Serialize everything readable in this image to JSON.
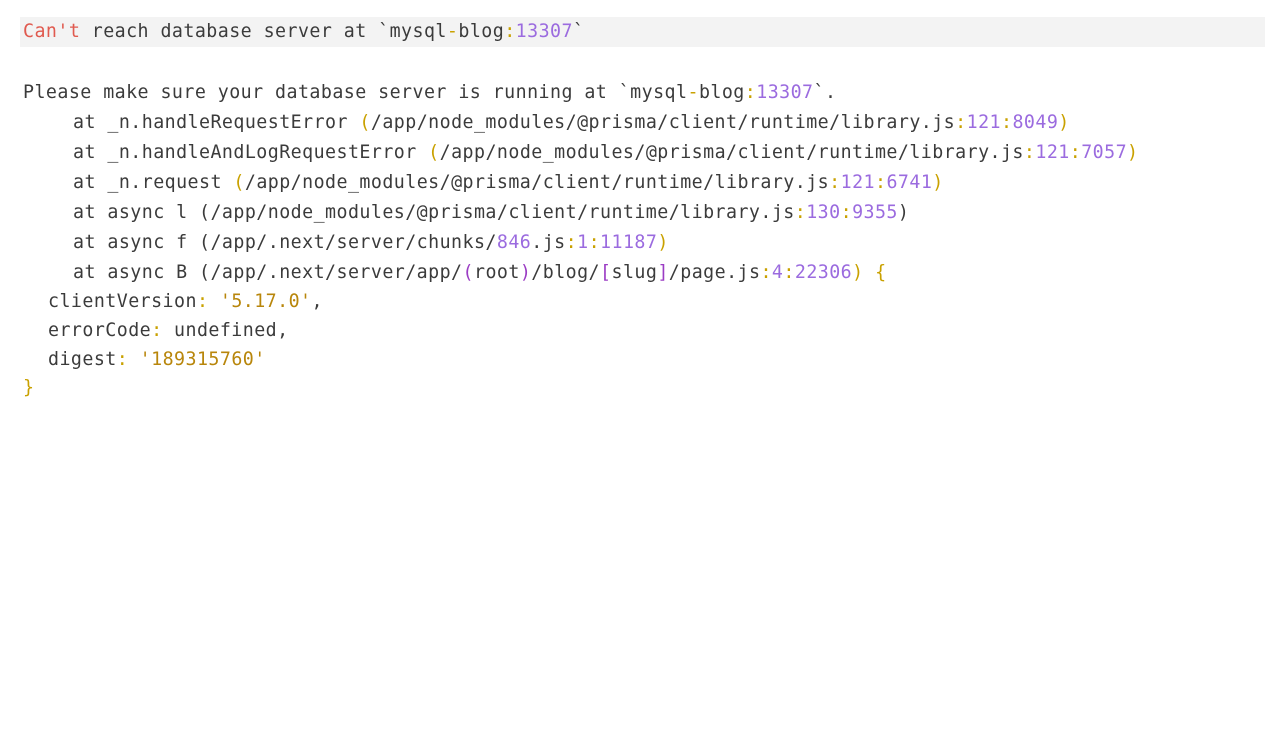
{
  "colors": {
    "background": "#ffffff",
    "highlight_bg": "#f3f3f3",
    "text": "#3b3b3b",
    "number": "#9b6bdf",
    "string": "#b8860b",
    "error_word": "#e05a4f",
    "punct": "#c9a100",
    "path": "#b3a14a",
    "bracket": "#9b3cc4"
  },
  "error_header": {
    "t1": "Can't",
    "t2": " reach database server at `mysql",
    "t3": "-",
    "t4": "blog",
    "t5": ":",
    "t6": "13307",
    "t7": "`"
  },
  "message": {
    "t1": "Please make sure your database server is running at `mysql",
    "t2": "-",
    "t3": "blog",
    "t4": ":",
    "t5": "13307",
    "t6": "`."
  },
  "stack": [
    {
      "t1": "at _n.handleRequestError ",
      "t2": "(",
      "t3": "/app/node_modules/@prisma/client/runtime/library.js",
      "t4": ":",
      "t5": "121",
      "t6": ":",
      "t7": "8049",
      "t8": ")"
    },
    {
      "t1": "at _n.handleAndLogRequestError ",
      "t2": "(",
      "t3": "/app/node_modules/@prisma/client/runtime/library.js",
      "t4": ":",
      "t5": "121",
      "t6": ":",
      "t7": "7057",
      "t8": ")"
    },
    {
      "t1": "at _n.request ",
      "t2": "(",
      "t3": "/app/node_modules/@prisma/client/runtime/library.js",
      "t4": ":",
      "t5": "121",
      "t6": ":",
      "t7": "6741",
      "t8": ")"
    },
    {
      "t1": "at async l (/app/node_modules/@prisma/client/runtime/library.js",
      "t2": ":",
      "t3": "130",
      "t4": ":",
      "t5": "9355",
      "t6": ")"
    },
    {
      "t1": "at async f (/app/.next/server/chunks/",
      "t2": "846",
      "t3": ".js",
      "t4": ":",
      "t5": "1",
      "t6": ":",
      "t7": "11187",
      "t8": ")"
    },
    {
      "t1": "at async B (/app/.next/server/app/",
      "t2": "(",
      "t3": "root",
      "t4": ")",
      "t5": "/blog/",
      "t6": "[",
      "t7": "slug",
      "t8": "]",
      "t9": "/page.js",
      "t10": ":",
      "t11": "4",
      "t12": ":",
      "t13": "22306",
      "t14": ") ",
      "t15": "{"
    }
  ],
  "props": [
    {
      "key": "clientVersion",
      "colon": ": ",
      "value": "'5.17.0'",
      "tail": ","
    },
    {
      "key": "errorCode",
      "colon": ": ",
      "value": "undefined",
      "tail": ","
    },
    {
      "key": "digest",
      "colon": ": ",
      "value": "'189315760'",
      "tail": ""
    }
  ],
  "closing": "}"
}
